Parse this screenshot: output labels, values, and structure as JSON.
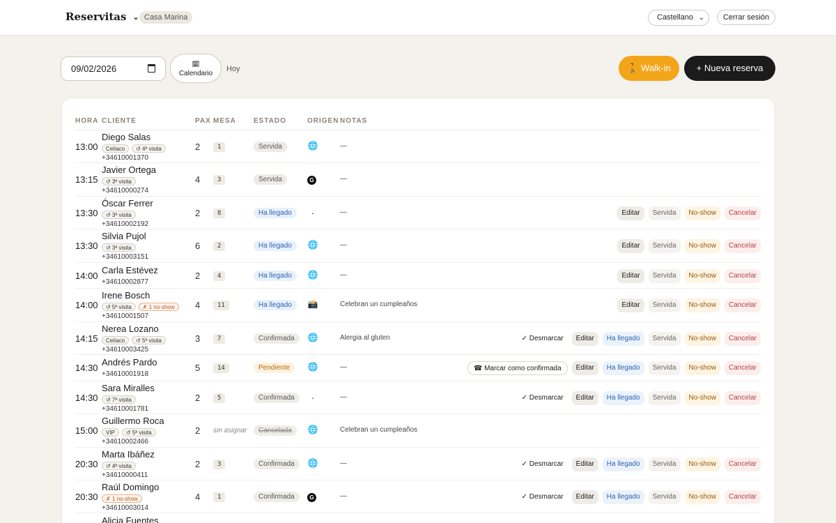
{
  "header": {
    "brand": "Reservitas",
    "venue": "Casa Marina",
    "language": "Castellano",
    "logout": "Cerrar sesión"
  },
  "toolbar": {
    "date": "09/02/2026",
    "calendar_icon": "🗓",
    "calendar_label": "Calendario",
    "today_label": "Hoy",
    "walkin_label": "🚶 Walk-in",
    "new_label": "+ Nueva reserva"
  },
  "columns": [
    "HORA",
    "CLIENTE",
    "PAX",
    "MESA",
    "ESTADO",
    "ORIGEN",
    "NOTAS"
  ],
  "labels": {
    "edit": "Editar",
    "servida": "Servida",
    "noshow": "No-show",
    "cancel": "Cancelar",
    "llegado": "Ha llegado",
    "desmarcar": "✓ Desmarcar",
    "marcar": "☎ Marcar como confirmada"
  },
  "rows": [
    {
      "time": "13:00",
      "name": "Diego Salas",
      "tags": [
        "Celíaco",
        "↺ 4ª visita"
      ],
      "phone": "+34610001370",
      "pax": "2",
      "mesa": "1",
      "status": "Servida",
      "status_kind": "servida",
      "origin": "web",
      "origin_glyph": "🌐",
      "notes": "—",
      "actions": []
    },
    {
      "time": "13:15",
      "name": "Javier Ortega",
      "tags": [
        "↺ 3ª visita"
      ],
      "phone": "+34610000274",
      "pax": "4",
      "mesa": "3",
      "status": "Servida",
      "status_kind": "servida",
      "origin": "google",
      "origin_glyph": "G",
      "notes": "—",
      "actions": []
    },
    {
      "time": "13:30",
      "name": "Óscar Ferrer",
      "tags": [
        "↺ 3ª visita"
      ],
      "phone": "+34610002192",
      "pax": "2",
      "mesa": "8",
      "status": "Ha llegado",
      "status_kind": "llegado",
      "origin": "phone",
      "origin_glyph": "·",
      "notes": "—",
      "actions": [
        "edit",
        "servida",
        "noshow",
        "cancel"
      ]
    },
    {
      "time": "13:30",
      "name": "Silvia Pujol",
      "tags": [
        "↺ 3ª visita"
      ],
      "phone": "+34610003151",
      "pax": "6",
      "mesa": "2",
      "status": "Ha llegado",
      "status_kind": "llegado",
      "origin": "web",
      "origin_glyph": "🌐",
      "notes": "—",
      "actions": [
        "edit",
        "servida",
        "noshow",
        "cancel"
      ]
    },
    {
      "time": "14:00",
      "name": "Carla Estévez",
      "tags": [],
      "phone": "+34610002877",
      "pax": "2",
      "mesa": "4",
      "status": "Ha llegado",
      "status_kind": "llegado",
      "origin": "web",
      "origin_glyph": "🌐",
      "notes": "—",
      "actions": [
        "edit",
        "servida",
        "noshow",
        "cancel"
      ]
    },
    {
      "time": "14:00",
      "name": "Irene Bosch",
      "tags": [
        "↺ 5ª visita",
        "✗ 1 no-show"
      ],
      "phone": "+34610001507",
      "pax": "4",
      "mesa": "11",
      "status": "Ha llegado",
      "status_kind": "llegado",
      "origin": "instagram",
      "origin_glyph": "📸",
      "notes": "Celebran un cumpleaños",
      "actions": [
        "edit",
        "servida",
        "noshow",
        "cancel"
      ]
    },
    {
      "time": "14:15",
      "name": "Nerea Lozano",
      "tags": [
        "Celíaco",
        "↺ 5ª visita"
      ],
      "phone": "+34610003425",
      "pax": "3",
      "mesa": "7",
      "status": "Confirmada",
      "status_kind": "confirmada",
      "origin": "web",
      "origin_glyph": "🌐",
      "notes": "Alergia al gluten",
      "actions": [
        "desmarcar",
        "edit",
        "llegado",
        "servida",
        "noshow",
        "cancel"
      ]
    },
    {
      "time": "14:30",
      "name": "Andrés Pardo",
      "tags": [],
      "phone": "+34610001918",
      "pax": "5",
      "mesa": "14",
      "status": "Pendiente",
      "status_kind": "pendiente",
      "origin": "web",
      "origin_glyph": "🌐",
      "notes": "—",
      "actions": [
        "marcar",
        "edit",
        "llegado",
        "servida",
        "noshow",
        "cancel"
      ]
    },
    {
      "time": "14:30",
      "name": "Sara Miralles",
      "tags": [
        "↺ 7ª visita"
      ],
      "phone": "+34610001781",
      "pax": "2",
      "mesa": "5",
      "status": "Confirmada",
      "status_kind": "confirmada",
      "origin": "phone",
      "origin_glyph": "·",
      "notes": "—",
      "actions": [
        "desmarcar",
        "edit",
        "llegado",
        "servida",
        "noshow",
        "cancel"
      ]
    },
    {
      "time": "15:00",
      "name": "Guillermo Roca",
      "tags": [
        "VIP",
        "↺ 5ª visita"
      ],
      "phone": "+34610002466",
      "pax": "2",
      "mesa": "sin asignar",
      "mesa_none": true,
      "status": "Cancelada",
      "status_kind": "cancelada",
      "origin": "web",
      "origin_glyph": "🌐",
      "notes": "Celebran un cumpleaños",
      "actions": []
    },
    {
      "time": "20:30",
      "name": "Marta Ibáñez",
      "tags": [
        "↺ 4ª visita"
      ],
      "phone": "+34610000411",
      "pax": "2",
      "mesa": "3",
      "status": "Confirmada",
      "status_kind": "confirmada",
      "origin": "web",
      "origin_glyph": "🌐",
      "notes": "—",
      "actions": [
        "desmarcar",
        "edit",
        "llegado",
        "servida",
        "noshow",
        "cancel"
      ]
    },
    {
      "time": "20:30",
      "name": "Raúl Domingo",
      "tags": [
        "✗ 1 no-show"
      ],
      "phone": "+34610003014",
      "pax": "4",
      "mesa": "1",
      "status": "Confirmada",
      "status_kind": "confirmada",
      "origin": "google",
      "origin_glyph": "G",
      "notes": "—",
      "actions": [
        "desmarcar",
        "edit",
        "llegado",
        "servida",
        "noshow",
        "cancel"
      ]
    },
    {
      "time": "",
      "name": "Alicia Fuentes",
      "tags": [],
      "phone": "",
      "pax": "",
      "mesa": "",
      "status": "",
      "status_kind": "",
      "origin": "",
      "origin_glyph": "",
      "notes": "",
      "actions": []
    }
  ]
}
